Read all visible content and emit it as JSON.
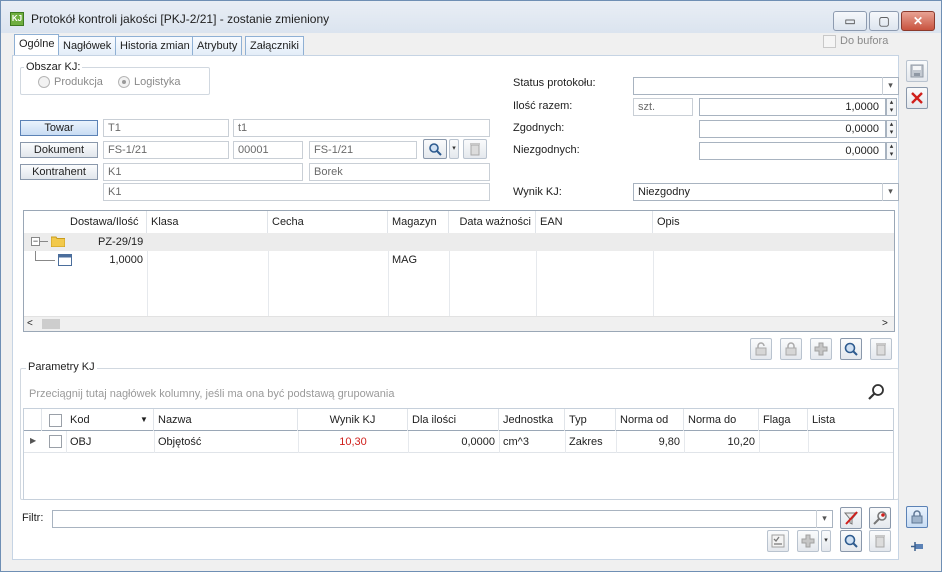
{
  "window": {
    "title": "Protokół kontroli jakości [PKJ-2/21] - zostanie zmieniony",
    "app_icon": "KJ",
    "minimize": "▭",
    "maximize": "▢",
    "close": "✕"
  },
  "tabs": [
    "Ogólne",
    "Nagłówek",
    "Historia zmian",
    "Atrybuty",
    "Załączniki"
  ],
  "do_bufora": "Do bufora",
  "obszar": {
    "title": "Obszar KJ:",
    "options": [
      "Produkcja",
      "Logistyka"
    ],
    "selected": "Logistyka"
  },
  "buttons": {
    "towar": "Towar",
    "dokument": "Dokument",
    "kontrahent": "Kontrahent"
  },
  "fields": {
    "towar_code": "T1",
    "towar_name": "t1",
    "dok_1": "FS-1/21",
    "dok_2": "00001",
    "dok_3": "FS-1/21",
    "kontr_code": "K1",
    "kontr_city": "Borek",
    "kontr_name": "K1"
  },
  "right_form": {
    "status_label": "Status protokołu:",
    "status_value": "",
    "ilosc_label": "Ilość razem:",
    "ilosc_unit": "szt.",
    "ilosc_value": "1,0000",
    "zgodnych_label": "Zgodnych:",
    "zgodnych_value": "0,0000",
    "niezgodnych_label": "Niezgodnych:",
    "niezgodnych_value": "0,0000",
    "wynik_label": "Wynik KJ:",
    "wynik_value": "Niezgodny"
  },
  "tree_grid": {
    "columns": [
      "Dostawa/Ilość",
      "Klasa",
      "Cecha",
      "Magazyn",
      "Data ważności",
      "EAN",
      "Opis"
    ],
    "group_row": "PZ-29/19",
    "child_row": {
      "qty": "1,0000",
      "magazyn": "MAG"
    }
  },
  "params": {
    "title": "Parametry KJ",
    "group_hint": "Przeciągnij tutaj nagłówek kolumny, jeśli ma ona być podstawą grupowania",
    "columns": [
      "Kod",
      "Nazwa",
      "Wynik KJ",
      "Dla ilości",
      "Jednostka",
      "Typ",
      "Norma od",
      "Norma do",
      "Flaga",
      "Lista"
    ],
    "row": {
      "kod": "OBJ",
      "nazwa": "Objętość",
      "wynik": "10,30",
      "dla_ilosci": "0,0000",
      "jednostka": "cm^3",
      "typ": "Zakres",
      "norma_od": "9,80",
      "norma_do": "10,20",
      "flaga": "",
      "lista": ""
    }
  },
  "filter": {
    "label": "Filtr:",
    "value": ""
  },
  "colors": {
    "accent": "#5b82b6",
    "wynik_red": "#d0201c",
    "close_red": "#c8533f"
  }
}
